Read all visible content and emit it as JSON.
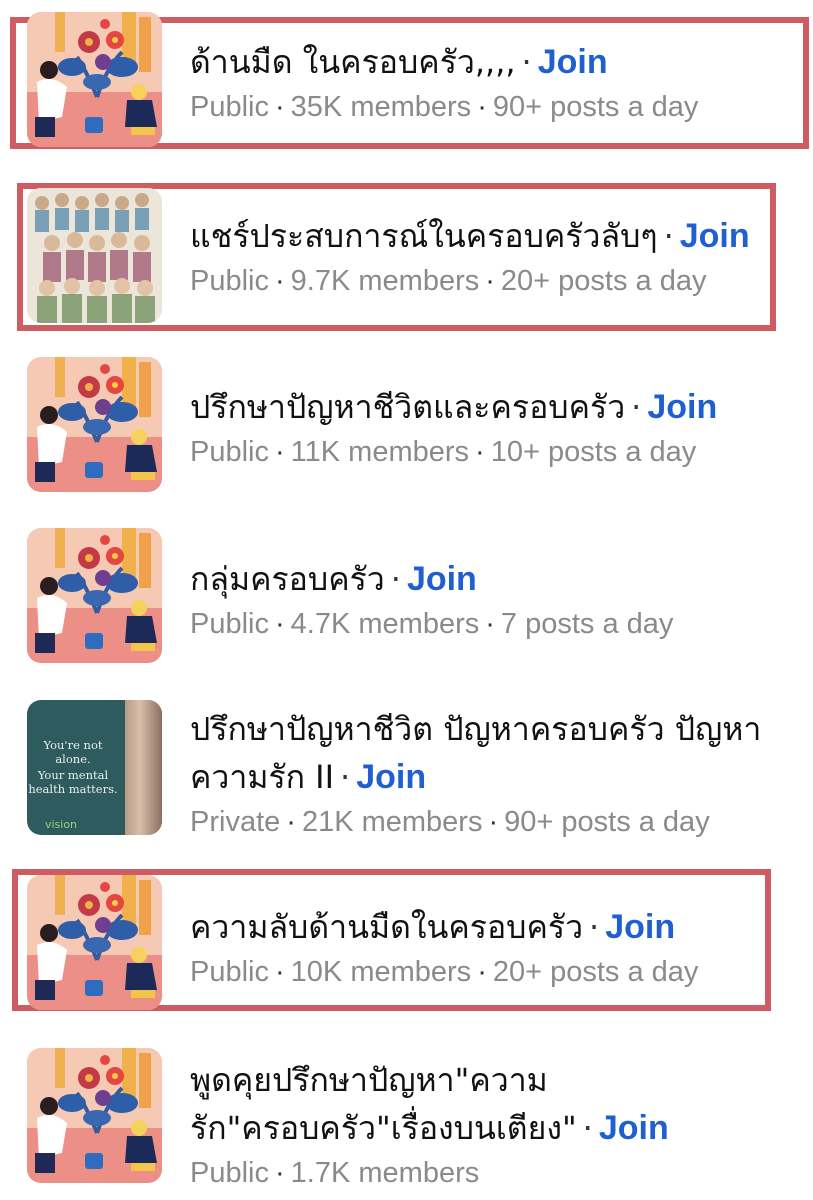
{
  "groups": [
    {
      "title": "ด้านมืด ในครอบครัว,,,,",
      "join": "Join",
      "privacy": "Public",
      "members": "35K members",
      "posts": "90+ posts a day",
      "highlighted": true,
      "thumb": "garden-illustration"
    },
    {
      "title": "แชร์ประสบการณ์ในครอบครัวลับๆ",
      "join": "Join",
      "privacy": "Public",
      "members": "9.7K members",
      "posts": "20+ posts a day",
      "highlighted": true,
      "thumb": "crowd-illustration"
    },
    {
      "title": "ปรึกษาปัญหาชีวิตและครอบครัว",
      "join": "Join",
      "privacy": "Public",
      "members": "11K members",
      "posts": "10+ posts a day",
      "highlighted": false,
      "thumb": "garden-illustration"
    },
    {
      "title": "กลุ่มครอบครัว",
      "join": "Join",
      "privacy": "Public",
      "members": "4.7K members",
      "posts": "7 posts a day",
      "highlighted": false,
      "thumb": "garden-illustration"
    },
    {
      "title_line1": "ปรึกษาปัญหาชีวิต ปัญหาครอบครัว ปัญหา",
      "title_line2": "ความรัก II",
      "join": "Join",
      "privacy": "Private",
      "members": "21K members",
      "posts": "90+ posts a day",
      "highlighted": false,
      "thumb": "mental-health-photo",
      "thumb_text": {
        "line1": "You're not alone.",
        "line2": "Your mental",
        "line3": "health matters.",
        "brand": "vision"
      }
    },
    {
      "title": "ความลับด้านมืดในครอบครัว",
      "join": "Join",
      "privacy": "Public",
      "members": "10K members",
      "posts": "20+ posts a day",
      "highlighted": true,
      "thumb": "garden-illustration"
    },
    {
      "title_line1": "พูดคุยปรึกษาปัญหา\"ความ",
      "title_line2": "รัก\"ครอบครัว\"เรื่องบนเตียง\"",
      "join": "Join",
      "privacy": "Public",
      "members": "1.7K members",
      "posts": "",
      "highlighted": false,
      "thumb": "garden-illustration"
    }
  ],
  "separator": "·",
  "colors": {
    "highlight": "#cd5c63",
    "join": "#1f5fd1",
    "meta": "#8a8a8a"
  }
}
